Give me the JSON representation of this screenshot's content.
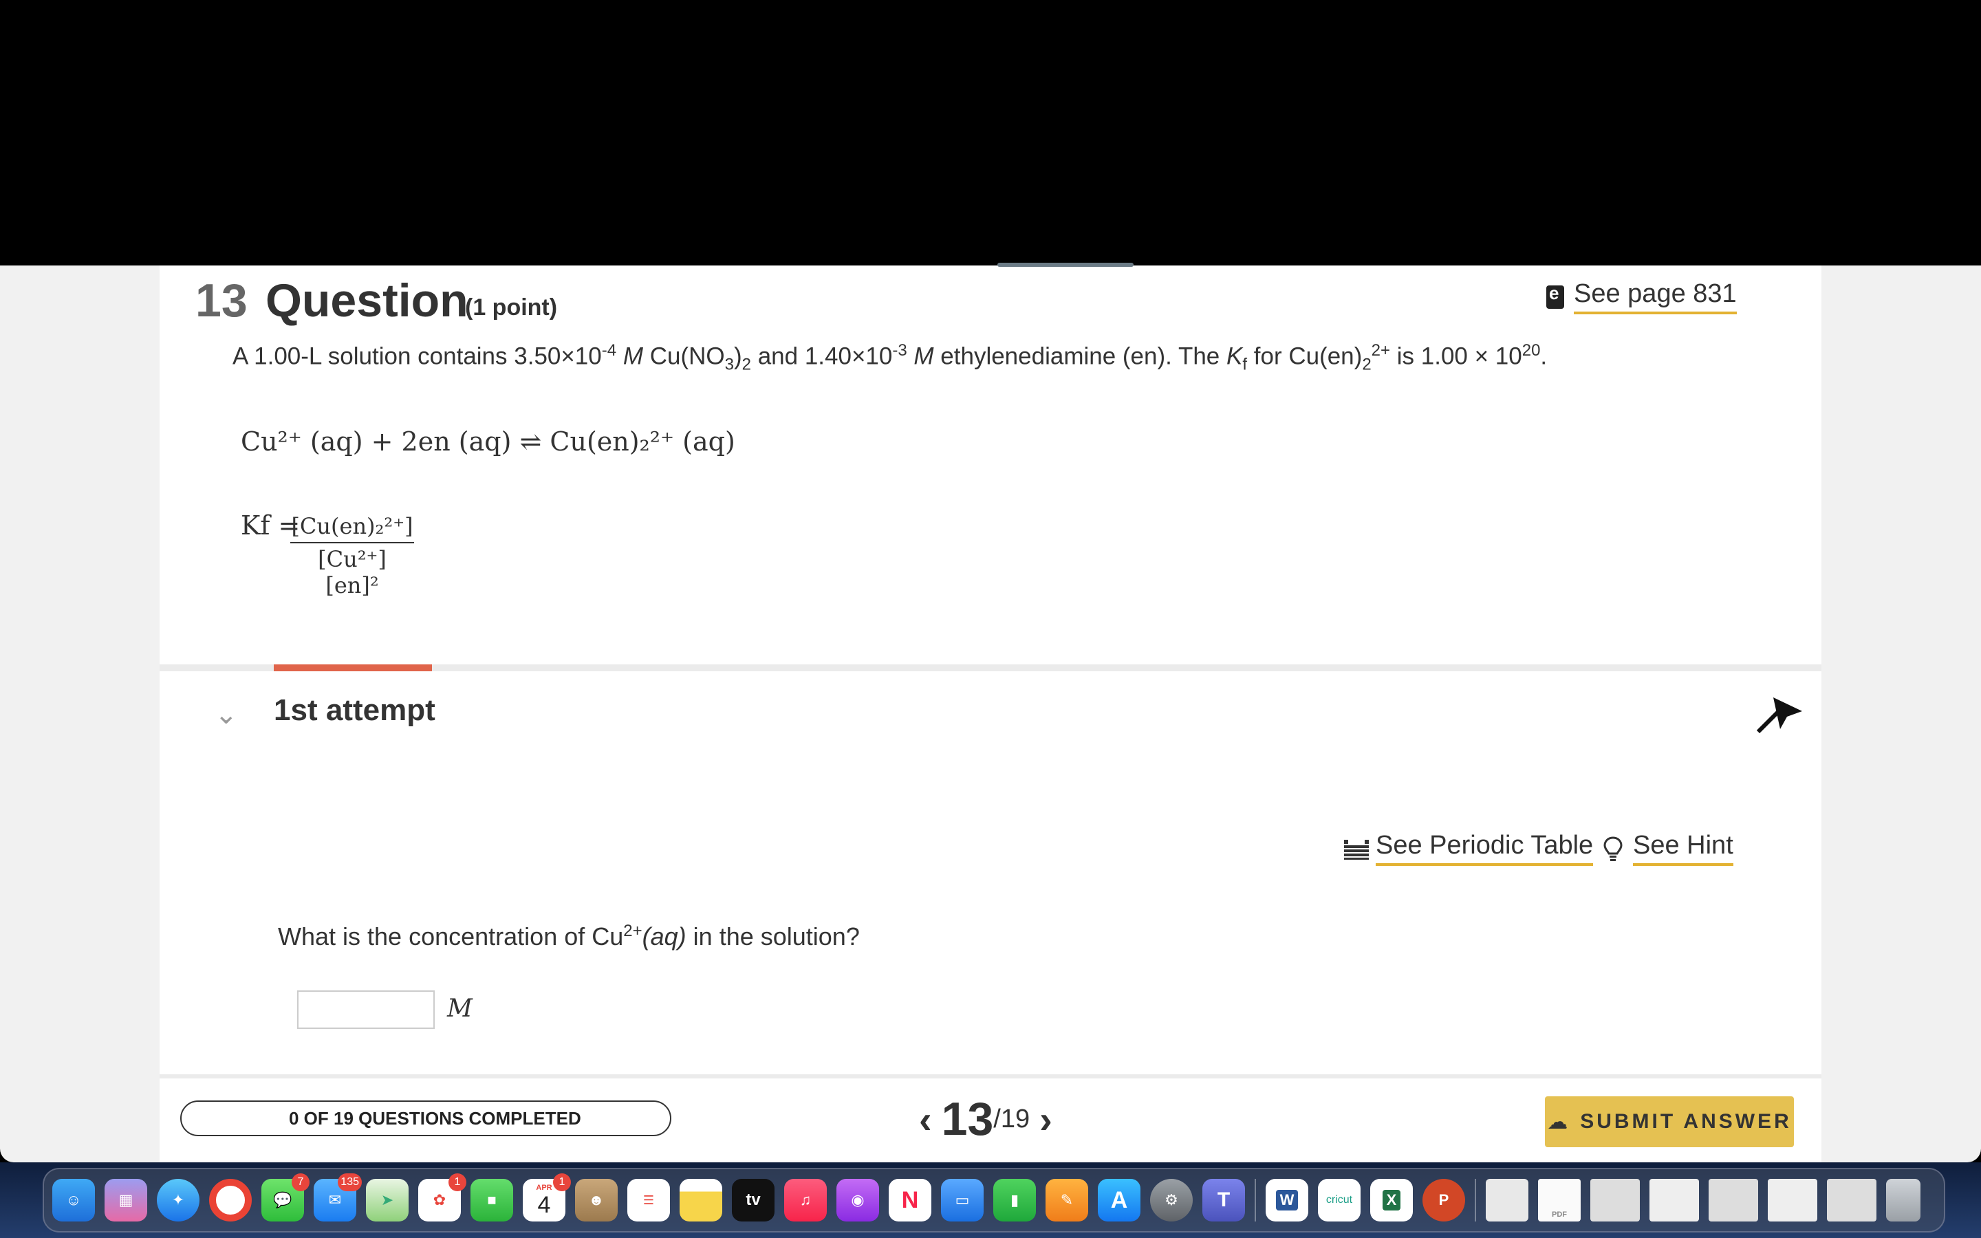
{
  "question": {
    "number": "13",
    "word": "Question",
    "points": "(1 point)",
    "see_page": "See page 831",
    "problem_parts": {
      "p1": "A 1.00-L solution contains 3.50×10",
      "exp1": "-4",
      "p2": " M",
      "p3": " Cu(NO",
      "sub1": "3",
      "p4": ")",
      "sub2": "2",
      "p5": " and 1.40×10",
      "exp2": "-3",
      "p6": " M",
      "p7": " ethylenediamine (en). The ",
      "kf": "K",
      "kfsub": "f",
      "p8": " for Cu(en)",
      "sub3": "2",
      "sup3": "2+",
      "p9": " is 1.00 × 10",
      "exp3": "20",
      "p10": "."
    },
    "equation": "Cu²⁺ (aq) + 2en (aq) ⇌ Cu(en)₂²⁺ (aq)",
    "kf_label": "Kf =",
    "kf_numerator": "[Cu(en)₂²⁺]",
    "kf_denominator": "[Cu²⁺] [en]²"
  },
  "attempt": {
    "label": "1st attempt",
    "see_periodic_table": "See Periodic Table",
    "see_hint": "See Hint",
    "question_pre": "What is the concentration of Cu",
    "question_sup": "2+",
    "question_aq": "(aq)",
    "question_post": " in the solution?",
    "input_value": "",
    "unit": "M"
  },
  "footer": {
    "progress": "0 OF 19 QUESTIONS COMPLETED",
    "current": "13",
    "total": "/19",
    "submit": "SUBMIT ANSWER"
  },
  "dock": {
    "badges": {
      "messages": "7",
      "mail": "135",
      "photos": "1",
      "calendar": "1"
    },
    "calendar_month": "APR",
    "calendar_day": "4",
    "tv_label": "tv",
    "word_label": "W",
    "cricut_label": "cricut",
    "excel_label": "X",
    "powerpoint_label": "P",
    "pdf_label": "PDF"
  },
  "colors": {
    "accent_yellow": "#e5c152",
    "attempt_accent": "#e0644a"
  }
}
